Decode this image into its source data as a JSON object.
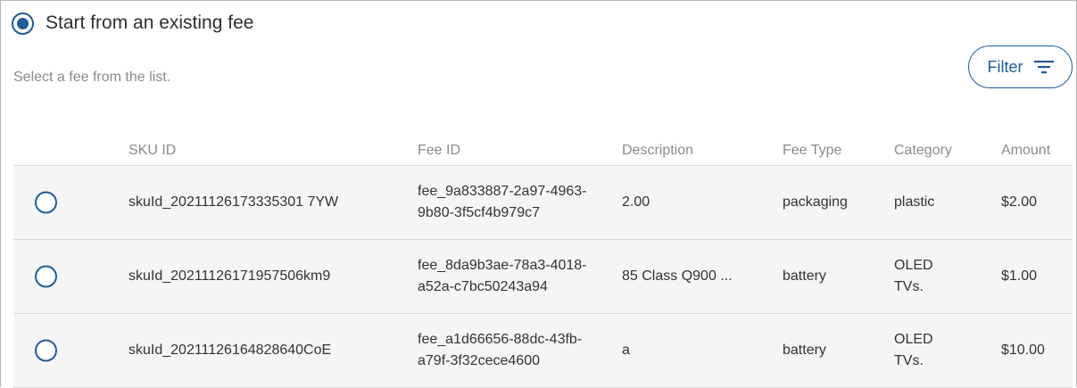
{
  "option": {
    "label": "Start from an existing fee",
    "selected": true
  },
  "hint": "Select a fee from the list.",
  "filter": {
    "label": "Filter",
    "icon": "filter-lines-icon"
  },
  "colors": {
    "accent": "#1f5c99",
    "row_bg": "#f5f5f5",
    "muted": "#8a8a8a"
  },
  "table": {
    "headers": {
      "sku": "SKU ID",
      "fee": "Fee ID",
      "desc": "Description",
      "type": "Fee Type",
      "cat": "Category",
      "amt": "Amount"
    },
    "rows": [
      {
        "sku": "skuId_20211126173335301 7YW",
        "fee": "fee_9a833887-2a97-4963-9b80-3f5cf4b979c7",
        "desc": "2.00",
        "type": "packaging",
        "cat": "plastic",
        "amt": "$2.00"
      },
      {
        "sku": "skuId_20211126171957506km9",
        "fee": "fee_8da9b3ae-78a3-4018-a52a-c7bc50243a94",
        "desc": "85 Class Q900 ...",
        "type": "battery",
        "cat": "OLED TVs.",
        "amt": "$1.00"
      },
      {
        "sku": "skuId_20211126164828640CoE",
        "fee": "fee_a1d66656-88dc-43fb-a79f-3f32cece4600",
        "desc": "a",
        "type": "battery",
        "cat": "OLED TVs.",
        "amt": "$10.00"
      }
    ]
  }
}
